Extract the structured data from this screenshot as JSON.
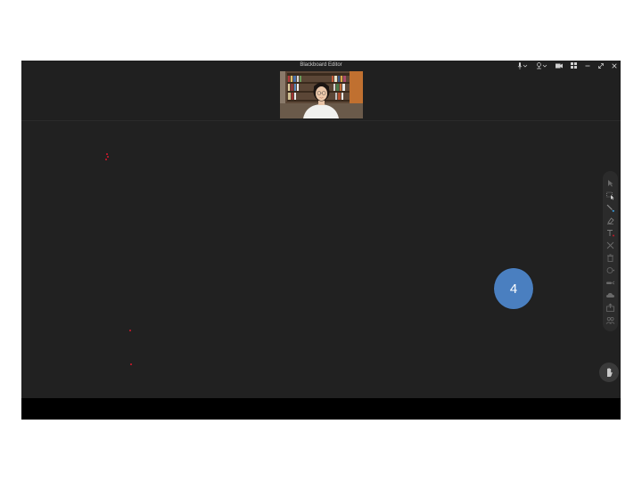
{
  "window": {
    "title": "Blackboard Editor"
  },
  "window_controls": [
    {
      "name": "microphone-icon",
      "glyph": "🎙"
    },
    {
      "name": "chevron-down-icon",
      "glyph": "⌄"
    },
    {
      "name": "speaker-icon",
      "glyph": "🔊"
    },
    {
      "name": "chevron-down-icon",
      "glyph": "⌄"
    },
    {
      "name": "camera-icon",
      "glyph": "■"
    },
    {
      "name": "grid-layout-icon",
      "glyph": "▦"
    },
    {
      "name": "minimize-icon",
      "glyph": "–"
    },
    {
      "name": "restore-icon",
      "glyph": "⤢"
    },
    {
      "name": "close-icon",
      "glyph": "✕"
    }
  ],
  "toolbar": {
    "tools": [
      "pointer-icon",
      "select-icon",
      "pen-icon",
      "eraser-icon",
      "text-icon",
      "shape-icon",
      "delete-icon",
      "clear-icon",
      "laser-icon",
      "cloud-icon",
      "upload-icon",
      "participants-icon"
    ]
  },
  "badge": {
    "label": "4"
  },
  "colors": {
    "board": "#212121",
    "badge": "#4a7fc0",
    "ink": "#c21a2a"
  }
}
